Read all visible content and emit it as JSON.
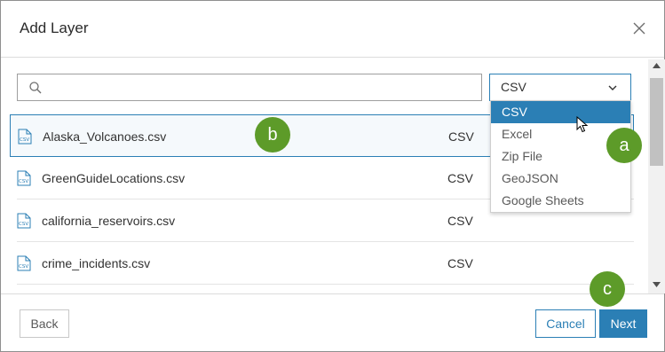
{
  "dialog": {
    "title": "Add Layer",
    "close_icon": "close-icon"
  },
  "search": {
    "placeholder": "",
    "value": "",
    "icon": "search-icon"
  },
  "type_filter": {
    "selected": "CSV",
    "icon": "chevron-down-icon",
    "options": [
      "CSV",
      "Excel",
      "Zip File",
      "GeoJSON",
      "Google Sheets"
    ],
    "highlighted_index": 0
  },
  "files": [
    {
      "name": "Alaska_Volcanoes.csv",
      "type": "CSV",
      "selected": true,
      "icon": "csv-file-icon"
    },
    {
      "name": "GreenGuideLocations.csv",
      "type": "CSV",
      "selected": false,
      "icon": "csv-file-icon"
    },
    {
      "name": "california_reservoirs.csv",
      "type": "CSV",
      "selected": false,
      "icon": "csv-file-icon"
    },
    {
      "name": "crime_incidents.csv",
      "type": "CSV",
      "selected": false,
      "icon": "csv-file-icon"
    }
  ],
  "footer": {
    "back_label": "Back",
    "cancel_label": "Cancel",
    "next_label": "Next"
  },
  "callouts": {
    "a": "a",
    "b": "b",
    "c": "c"
  },
  "colors": {
    "accent": "#2b7fb5",
    "callout": "#5d9b29",
    "selected_row_bg": "#f5f9fc"
  }
}
